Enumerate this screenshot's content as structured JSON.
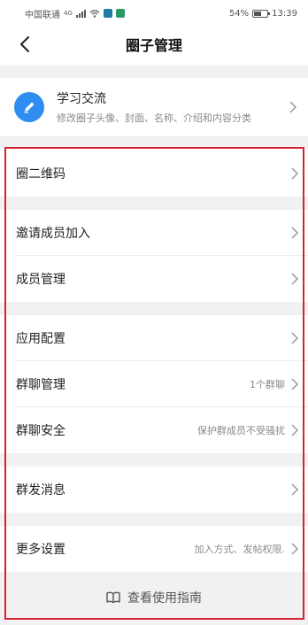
{
  "status_bar": {
    "carrier": "中国联通",
    "signal_tag": "4G",
    "battery": "54%",
    "time": "13:39"
  },
  "nav": {
    "title": "圈子管理"
  },
  "profile": {
    "name": "学习交流",
    "description": "修改圈子头像、封面、名称、介绍和内容分类"
  },
  "rows": {
    "qr_code": {
      "label": "圈二维码"
    },
    "invite": {
      "label": "邀请成员加入"
    },
    "members": {
      "label": "成员管理"
    },
    "app_config": {
      "label": "应用配置"
    },
    "group_chat": {
      "label": "群聊管理",
      "value": "1个群聊"
    },
    "chat_security": {
      "label": "群聊安全",
      "value": "保护群成员不受骚扰"
    },
    "broadcast": {
      "label": "群发消息"
    },
    "more_settings": {
      "label": "更多设置",
      "value": "加入方式、发帖权限."
    }
  },
  "guide": {
    "label": "查看使用指南"
  },
  "colors": {
    "accent": "#2f8cf0",
    "highlight_frame": "#d5232f",
    "section_gap": "#f1f1f3"
  }
}
